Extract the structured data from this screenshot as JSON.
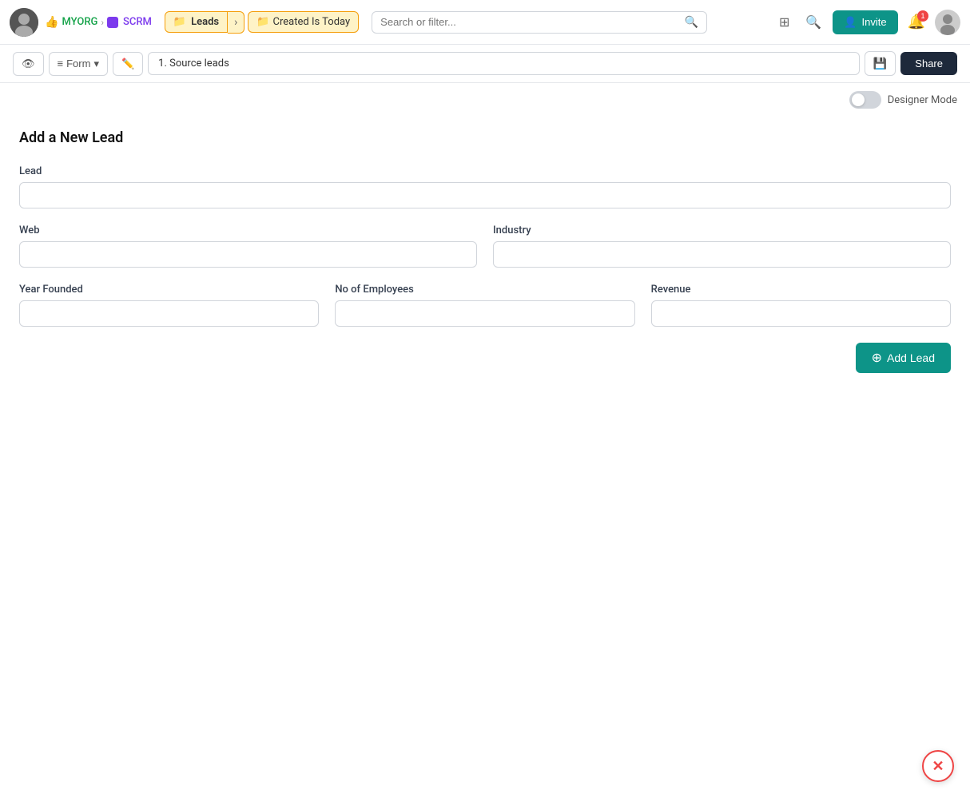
{
  "navbar": {
    "org_name": "MYORG",
    "scrm_name": "SCRM",
    "leads_label": "Leads",
    "filter_label": "Created  Is  Today",
    "search_placeholder": "Search or filter...",
    "invite_label": "Invite",
    "notification_count": "1"
  },
  "toolbar": {
    "form_label": "Form",
    "pipeline_step": "1. Source leads",
    "share_label": "Share"
  },
  "designer_mode": {
    "label": "Designer Mode"
  },
  "form": {
    "title": "Add a New Lead",
    "lead_label": "Lead",
    "web_label": "Web",
    "industry_label": "Industry",
    "year_founded_label": "Year Founded",
    "no_employees_label": "No of Employees",
    "revenue_label": "Revenue",
    "add_lead_label": "Add Lead"
  }
}
